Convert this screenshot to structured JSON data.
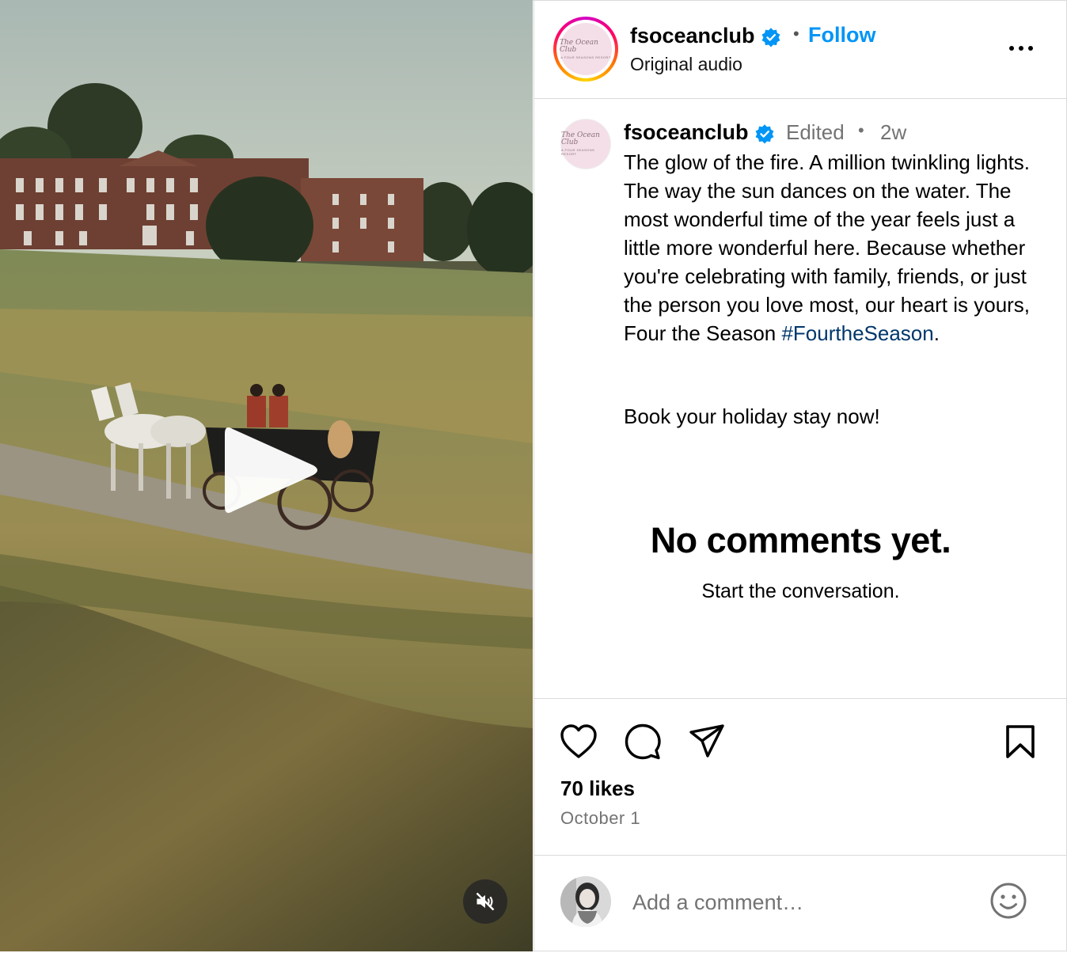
{
  "header": {
    "username": "fsoceanclub",
    "follow_label": "Follow",
    "audio": "Original audio",
    "avatar_logo_text": "The Ocean Club",
    "avatar_logo_sub": "A FOUR SEASONS RESORT"
  },
  "caption": {
    "username": "fsoceanclub",
    "edited": "Edited",
    "time_ago": "2w",
    "text": "The glow of the fire. A million twinkling lights. The way the sun dances on the water. The most wonderful time of the year feels just a little more wonderful here. Because whether you're celebrating with family, friends, or just the person you love most, our heart is yours, Four the Season ",
    "hashtag": "#FourtheSeason",
    "text_end": ".",
    "cta": "Book your holiday stay now!"
  },
  "comments": {
    "empty_title": "No comments yet.",
    "empty_subtitle": "Start the conversation."
  },
  "stats": {
    "likes": "70 likes",
    "date": "October 1"
  },
  "comment_box": {
    "placeholder": "Add a comment…"
  },
  "icons": {
    "like": "heart-icon",
    "comment": "comment-icon",
    "share": "share-icon",
    "save": "bookmark-icon",
    "more": "more-icon",
    "emoji": "emoji-icon",
    "play": "play-icon",
    "mute": "muted-speaker-icon",
    "verified": "verified-badge-icon"
  },
  "colors": {
    "follow": "#0095f6",
    "verified": "#0095f6",
    "hashtag": "#00376b",
    "secondary_text": "#737373",
    "border": "#dbdbdb"
  }
}
